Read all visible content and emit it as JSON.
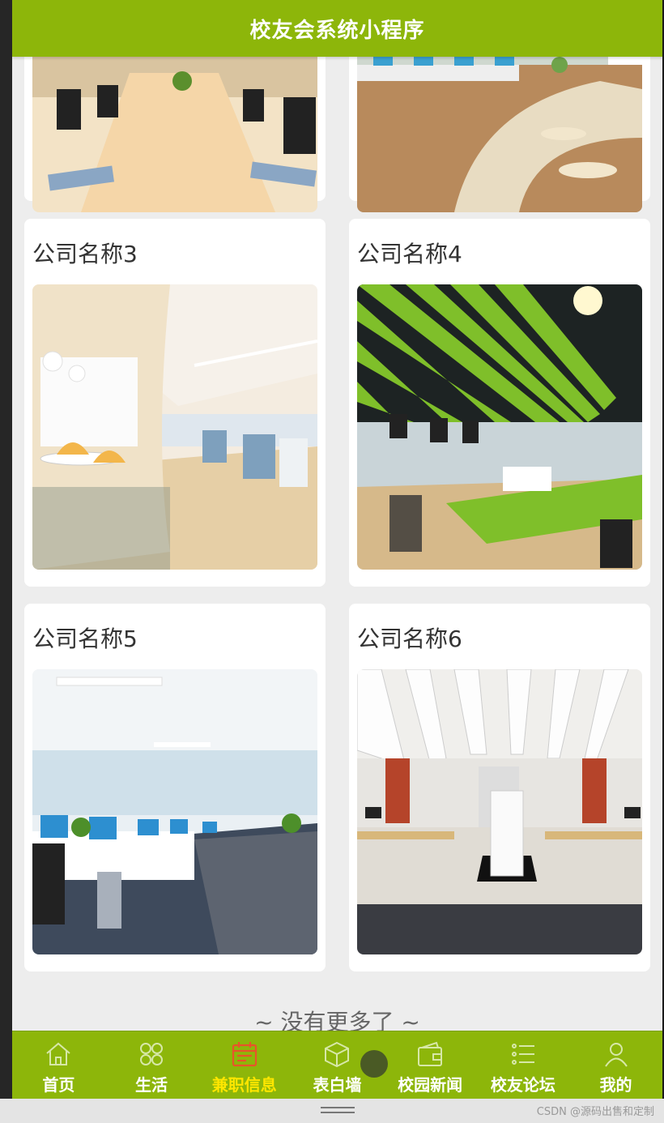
{
  "header": {
    "title": "校友会系统小程序"
  },
  "companies": [
    {
      "name": ""
    },
    {
      "name": ""
    },
    {
      "name": "公司名称3"
    },
    {
      "name": "公司名称4"
    },
    {
      "name": "公司名称5"
    },
    {
      "name": "公司名称6"
    }
  ],
  "list_end_text": "~ 没有更多了 ~",
  "tabbar": {
    "items": [
      {
        "label": "首页",
        "icon": "home-icon"
      },
      {
        "label": "生活",
        "icon": "grid-icon"
      },
      {
        "label": "兼职信息",
        "icon": "calendar-icon",
        "active": true
      },
      {
        "label": "表白墙",
        "icon": "box-icon"
      },
      {
        "label": "校园新闻",
        "icon": "wallet-icon"
      },
      {
        "label": "校友论坛",
        "icon": "list-icon"
      },
      {
        "label": "我的",
        "icon": "user-icon"
      }
    ],
    "active_color": "#ffe600"
  },
  "watermark": "CSDN @源码出售和定制",
  "colors": {
    "primary": "#8db60a",
    "background": "#ededed"
  }
}
